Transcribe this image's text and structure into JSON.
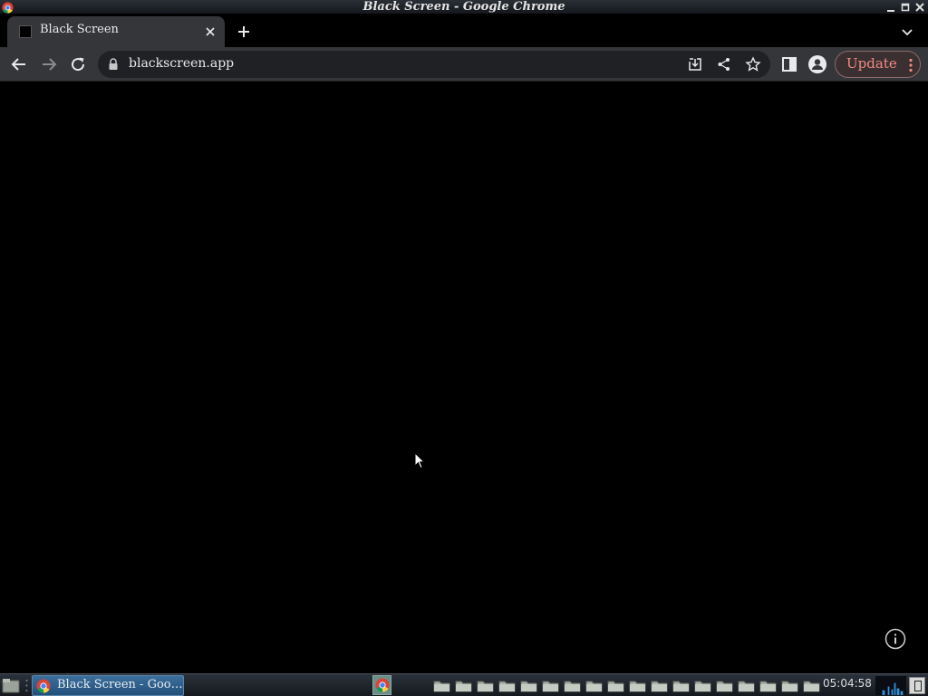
{
  "window": {
    "title": "Black Screen - Google Chrome"
  },
  "tabs": [
    {
      "title": "Black Screen",
      "active": true
    }
  ],
  "toolbar": {
    "url": "blackscreen.app",
    "update_label": "Update"
  },
  "taskbar": {
    "task_label": "Black Screen - Goo…",
    "clock": "05:04:58",
    "workspace_count": 18
  },
  "colors": {
    "page_background": "#000000",
    "toolbar": "#35363a",
    "omnibox": "#202124",
    "update_accent": "#f28b82",
    "taskbar_active": "#2f6290"
  },
  "icons": {
    "window_controls": [
      "minimize-icon",
      "maximize-icon",
      "close-icon"
    ],
    "toolbar": [
      "back-arrow-icon",
      "forward-arrow-icon",
      "reload-icon",
      "lock-icon",
      "install-app-icon",
      "share-icon",
      "bookmark-star-icon",
      "side-panel-icon",
      "profile-icon",
      "kebab-menu-icon"
    ],
    "page": [
      "info-icon",
      "mouse-cursor-icon"
    ]
  }
}
